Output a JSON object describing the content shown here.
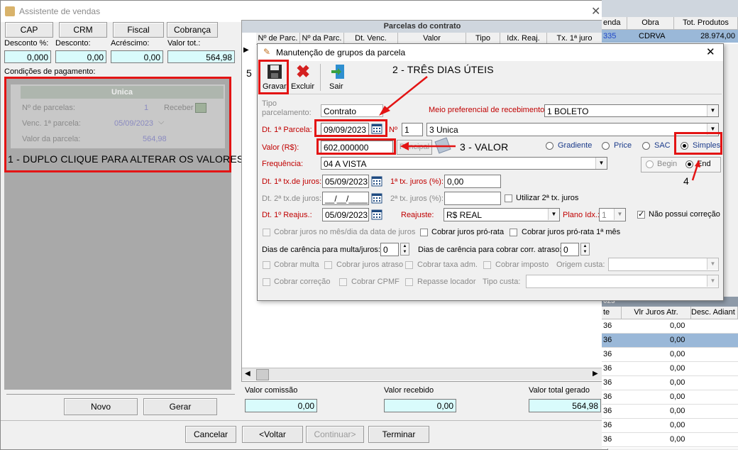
{
  "main_window": {
    "title": "Assistente de vendas",
    "tabs": [
      "CAP",
      "CRM",
      "Fiscal",
      "Cobrança"
    ],
    "fields": {
      "desconto_pct_label": "Desconto %:",
      "desconto_pct_value": "0,000",
      "desconto_label": "Desconto:",
      "desconto_value": "0,00",
      "acrescimo_label": "Acréscimo:",
      "acrescimo_value": "0,00",
      "valor_tot_label": "Valor tot.:",
      "valor_tot_value": "564,98"
    },
    "condicoes_label": "Condições de pagamento:",
    "unica": {
      "header": "Unica",
      "n_parcelas_label": "Nº de parcelas:",
      "n_parcelas_value": "1",
      "receber_label": "Receber",
      "venc_label": "Venc. 1ª parcela:",
      "venc_value": "05/09/2023",
      "valor_parcela_label": "Valor da parcela:",
      "valor_parcela_value": "564,98"
    },
    "buttons": {
      "novo": "Novo",
      "gerar": "Gerar",
      "cancelar": "Cancelar",
      "voltar": "<Voltar",
      "continuar": "Continuar>",
      "terminar": "Terminar"
    },
    "totals": {
      "comissao_label": "Valor comissão",
      "comissao_value": "0,00",
      "recebido_label": "Valor recebido",
      "recebido_value": "0,00",
      "total_label": "Valor total gerado",
      "total_value": "564,98"
    }
  },
  "parcelas_grid": {
    "title": "Parcelas do contrato",
    "headers": [
      "Nº de Parc.",
      "Nº da Parc.",
      "Dt. Venc.",
      "Valor",
      "Tipo",
      "Idx. Reaj.",
      "Tx. 1ª juro"
    ]
  },
  "right_grid": {
    "headers": [
      "enda",
      "Obra",
      "Tot. Produtos"
    ],
    "row": [
      "335",
      "CDRVA",
      "28.974,00"
    ],
    "section_label": "023 ***",
    "lower_headers": [
      "te",
      "Vlr Juros Atr.",
      "Desc. Adiant"
    ],
    "lower_rows": [
      [
        "36",
        "0,00"
      ],
      [
        "36",
        "0,00"
      ],
      [
        "36",
        "0,00"
      ],
      [
        "36",
        "0,00"
      ],
      [
        "36",
        "0,00"
      ],
      [
        "36",
        "0,00"
      ],
      [
        "36",
        "0,00"
      ],
      [
        "36",
        "0,00"
      ],
      [
        "36",
        "0,00"
      ],
      [
        "36",
        "0,00"
      ]
    ]
  },
  "dialog": {
    "title": "Manutenção de grupos da parcela",
    "toolbar": {
      "gravar": "Gravar",
      "excluir": "Excluir",
      "sair": "Sair"
    },
    "tipo_label": "Tipo parcelamento:",
    "tipo_value": "Contrato",
    "meio_label": "Meio preferencial de recebimento:",
    "meio_value": "1 BOLETO",
    "dt1_label": "Dt. 1ª Parcela:",
    "dt1_value": "09/09/2023",
    "n_label": "Nº",
    "n_value": "1",
    "n_select": "3 Unica",
    "valor_label": "Valor (R$):",
    "valor_value": "602,000000",
    "principal_label": "Principal",
    "radios": {
      "gradiente": "Gradiente",
      "price": "Price",
      "sac": "SAC",
      "simples": "Simples"
    },
    "begin_label": "Begin",
    "end_label": "End",
    "freq_label": "Frequência:",
    "freq_value": "04 A VISTA",
    "dt1tx_label": "Dt. 1ª tx.de juros:",
    "dt1tx_value": "05/09/2023",
    "tx1_label": "1ª tx. juros (%):",
    "tx1_value": "0,00",
    "dt2tx_label": "Dt. 2ª tx.de juros:",
    "dt2tx_value": "__/__/____",
    "tx2_label": "2ª tx. juros (%):",
    "utilizar_label": "Utilizar 2ª tx. juros",
    "dtreaj_label": "Dt. 1º Reajus.:",
    "dtreaj_value": "05/09/2023",
    "reajuste_label": "Reajuste:",
    "reajuste_value": "R$ REAL",
    "plano_label": "Plano Idx.:",
    "plano_value": "1",
    "nao_possui_label": "Não possui correção",
    "cobrar_juros_mes_label": "Cobrar juros no mês/dia da data de juros",
    "cobrar_pro_rata_label": "Cobrar juros pró-rata",
    "cobrar_pro_rata_1_label": "Cobrar juros pró-rata 1ª mês",
    "dias_multa_label": "Dias de carência para multa/juros:",
    "dias_multa_value": "0",
    "dias_corr_label": "Dias de carência para cobrar corr. atraso:",
    "dias_corr_value": "0",
    "cobrar_multa_label": "Cobrar multa",
    "cobrar_juros_atraso_label": "Cobrar juros atraso",
    "cobrar_taxa_label": "Cobrar taxa adm.",
    "cobrar_imposto_label": "Cobrar imposto",
    "origem_label": "Origem custa:",
    "cobrar_correcao_label": "Cobrar correção",
    "cobrar_cpmf_label": "Cobrar CPMF",
    "repasse_label": "Repasse locador",
    "tipo_custa_label": "Tipo custa:"
  },
  "annotations": {
    "a1": "1 - DUPLO CLIQUE PARA ALTERAR OS VALORES",
    "a2": "2 - TRÊS DIAS ÚTEIS",
    "a3": "3 - VALOR",
    "a4": "4",
    "a5": "5"
  },
  "colors": {
    "highlight": "#e31414",
    "cyan_field": "#d9fbfc",
    "selected_row": "#9ab8d8"
  }
}
